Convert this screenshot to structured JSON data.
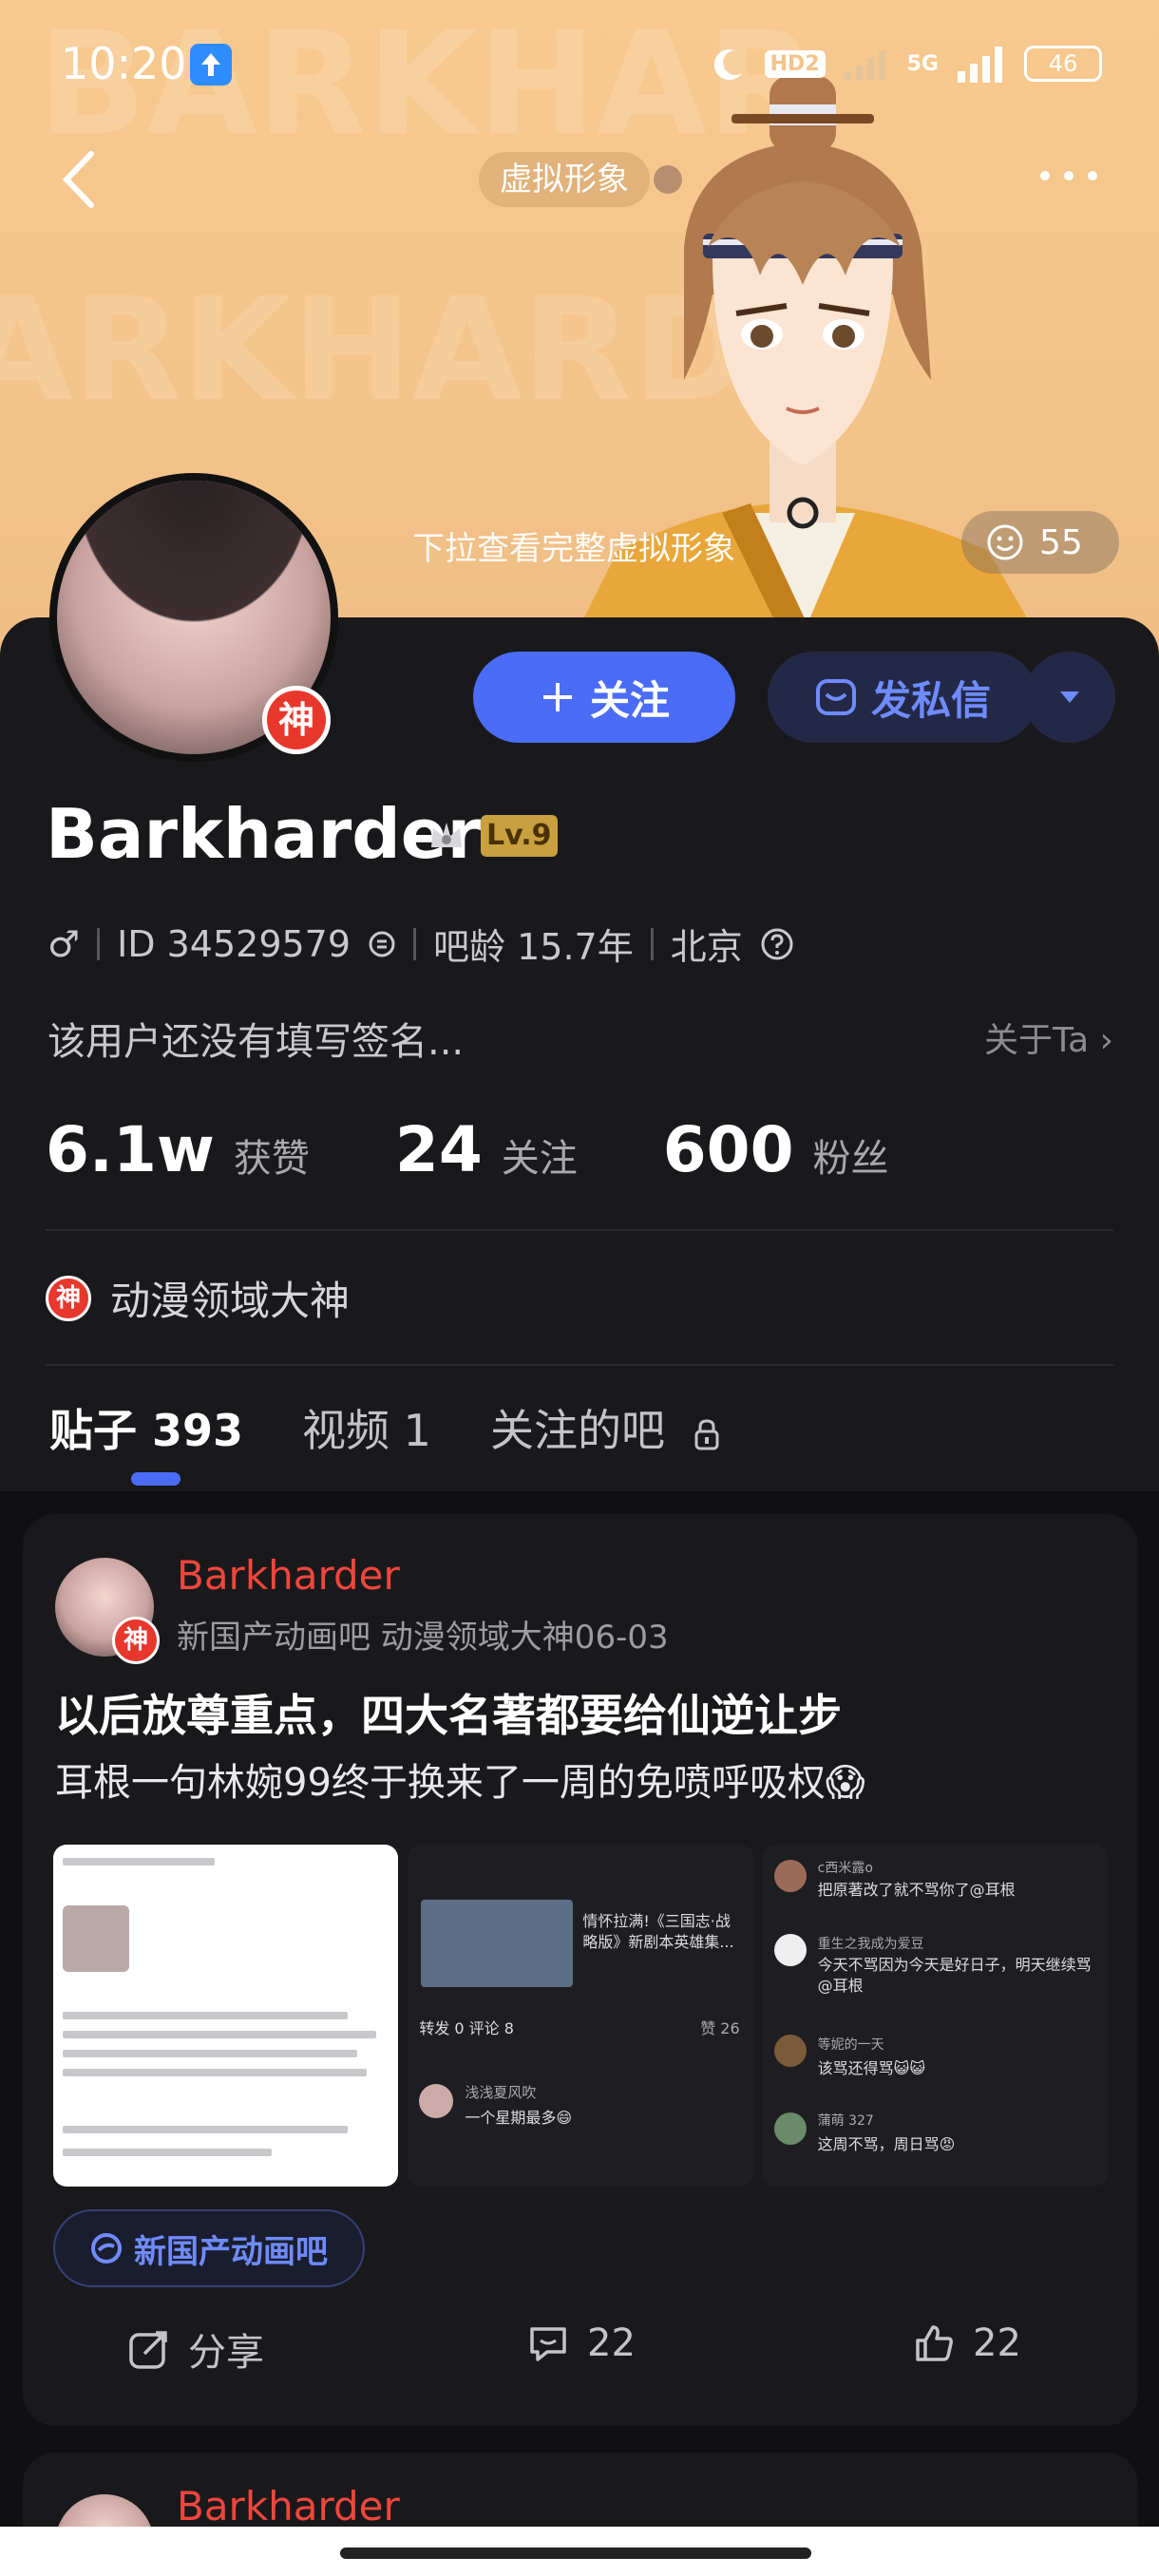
{
  "status_bar": {
    "time": "10:20",
    "network": "5G",
    "hd_label": "HD2",
    "battery": "46"
  },
  "header": {
    "avatar_tag": "虚拟形象",
    "pull_hint": "下拉查看完整虚拟形象",
    "like_count": "55"
  },
  "profile": {
    "name": "Barkharder",
    "level": "Lv.9",
    "god_badge": "神",
    "gender": "♂",
    "id_text": "ID 34529579",
    "age_text": "吧龄 15.7年",
    "location": "北京",
    "signature": "该用户还没有填写签名...",
    "about_label": "关于Ta",
    "title": "动漫领域大神",
    "stats": [
      {
        "value": "6.1w",
        "label": "获赞"
      },
      {
        "value": "24",
        "label": "关注"
      },
      {
        "value": "600",
        "label": "粉丝"
      }
    ],
    "buttons": {
      "follow": "关注",
      "message": "发私信"
    }
  },
  "tabs": [
    {
      "label": "贴子 393"
    },
    {
      "label": "视频 1"
    },
    {
      "label": "关注的吧"
    }
  ],
  "post": {
    "author": "Barkharder",
    "subline": "新国产动画吧   动漫领域大神06-03",
    "title": "以后放尊重点，四大名著都要给仙逆让步",
    "body": "耳根一句林婉99终于换来了一周的免喷呼吸权😱",
    "forum": "新国产动画吧",
    "share": "分享",
    "comments": "22",
    "likes": "22",
    "image_text": {
      "img2_title": "情怀拉满!《三国志·战略版》新剧本英雄集...",
      "img2_tabs": "转发 0   评论 8",
      "img2_likes": "赞 26",
      "img2_user": "浅浅夏风吹",
      "img2_comment": "一个星期最多😄",
      "img3_c1_user": "c西米露o",
      "img3_c1": "把原著改了就不骂你了@耳根",
      "img3_c2_user": "重生之我成为爱豆",
      "img3_c2": "今天不骂因为今天是好日子，明天继续骂@耳根",
      "img3_c3_user": "等妮的一天",
      "img3_c3": "该骂还得骂😺😺",
      "img3_c4_user": "蒲萌 327",
      "img3_c4": "这周不骂，周日骂😡"
    }
  },
  "post2": {
    "author": "Barkharder"
  },
  "colors": {
    "accent": "#4a6cf7",
    "author": "#f0463c",
    "banner": "#f4c48b",
    "god": "#e8372d"
  }
}
